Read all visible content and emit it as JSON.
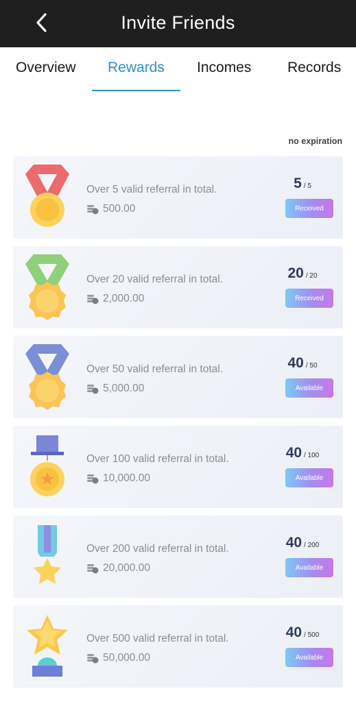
{
  "header": {
    "title": "Invite Friends",
    "back_icon": "chevron-left-icon"
  },
  "tabs": [
    {
      "label": "Overview"
    },
    {
      "label": "Rewards"
    },
    {
      "label": "Incomes"
    },
    {
      "label": "Records"
    }
  ],
  "active_tab": "Rewards",
  "expiry_note": "no expiration",
  "rewards": [
    {
      "description": "Over 5 valid referral in total.",
      "amount": "500.00",
      "current": "5",
      "target": "/ 5",
      "status": "Received",
      "medal_icon": "red-ribbon-medal-icon"
    },
    {
      "description": "Over 20 valid referral in total.",
      "amount": "2,000.00",
      "current": "20",
      "target": "/ 20",
      "status": "Received",
      "medal_icon": "green-ribbon-medal-icon"
    },
    {
      "description": "Over 50 valid referral in total.",
      "amount": "5,000.00",
      "current": "40",
      "target": "/ 50",
      "status": "Available",
      "medal_icon": "blue-ribbon-medal-icon"
    },
    {
      "description": "Over 100 valid referral in total.",
      "amount": "10,000.00",
      "current": "40",
      "target": "/ 100",
      "status": "Available",
      "medal_icon": "pin-medal-icon"
    },
    {
      "description": "Over 200 valid referral in total.",
      "amount": "20,000.00",
      "current": "40",
      "target": "/ 200",
      "status": "Available",
      "medal_icon": "star-ribbon-medal-icon"
    },
    {
      "description": "Over 500 valid referral in total.",
      "amount": "50,000.00",
      "current": "40",
      "target": "/ 500",
      "status": "Available",
      "medal_icon": "star-trophy-icon"
    }
  ],
  "colors": {
    "header_bg": "#1f1f1f",
    "active_tab": "#2f90c8",
    "progress_text": "#2f3a63",
    "button_gradient": [
      "#7cc8f6",
      "#a48cf0",
      "#c776e8"
    ]
  }
}
